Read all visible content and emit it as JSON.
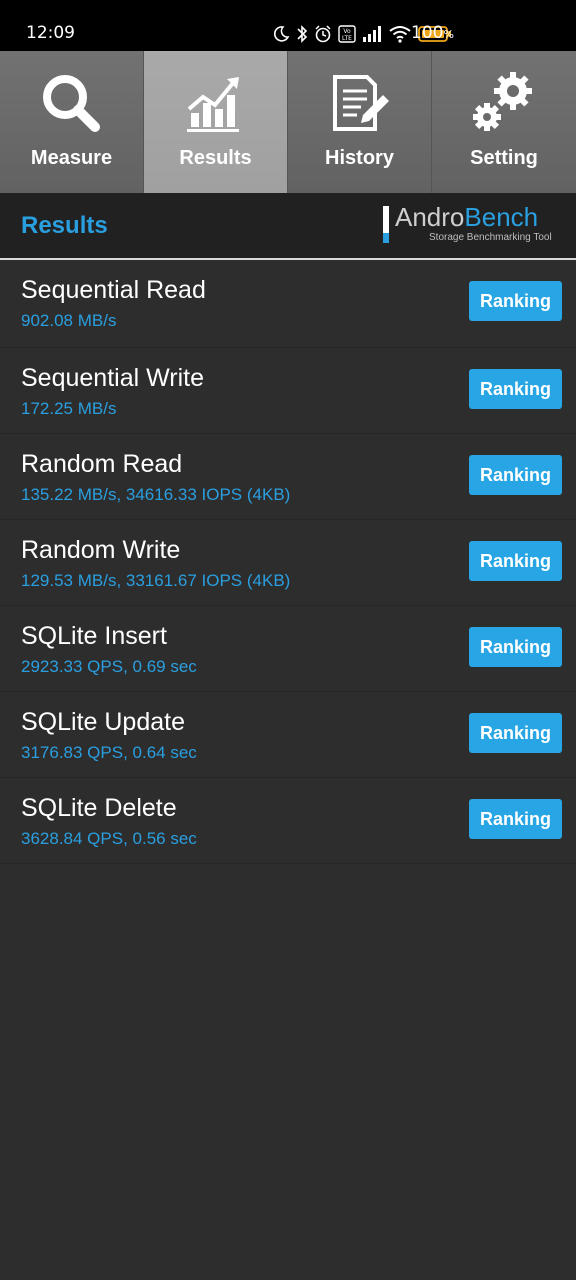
{
  "status_bar": {
    "time": "12:09",
    "battery_pct": "100",
    "icons": [
      "moon-icon",
      "bluetooth-icon",
      "alarm-icon",
      "volte-icon",
      "signal-icon",
      "wifi-icon",
      "battery-icon"
    ]
  },
  "tabs": [
    {
      "label": "Measure",
      "icon": "magnifier-icon"
    },
    {
      "label": "Results",
      "icon": "chart-icon",
      "active": true
    },
    {
      "label": "History",
      "icon": "document-pencil-icon"
    },
    {
      "label": "Setting",
      "icon": "gears-icon"
    }
  ],
  "header": {
    "title": "Results",
    "brand_part1": "Andro",
    "brand_part2": "Bench",
    "brand_tagline": "Storage Benchmarking Tool"
  },
  "results": [
    {
      "name": "Sequential Read",
      "value": "902.08 MB/s",
      "button": "Ranking"
    },
    {
      "name": "Sequential Write",
      "value": "172.25 MB/s",
      "button": "Ranking"
    },
    {
      "name": "Random Read",
      "value": "135.22 MB/s, 34616.33 IOPS (4KB)",
      "button": "Ranking"
    },
    {
      "name": "Random Write",
      "value": "129.53 MB/s, 33161.67 IOPS (4KB)",
      "button": "Ranking"
    },
    {
      "name": "SQLite Insert",
      "value": "2923.33 QPS, 0.69 sec",
      "button": "Ranking"
    },
    {
      "name": "SQLite Update",
      "value": "3176.83 QPS, 0.64 sec",
      "button": "Ranking"
    },
    {
      "name": "SQLite Delete",
      "value": "3628.84 QPS, 0.56 sec",
      "button": "Ranking"
    }
  ],
  "colors": {
    "accent": "#2a9fe0",
    "button": "#27a5e4",
    "background": "#2d2d2d",
    "header_bg": "#212121"
  }
}
